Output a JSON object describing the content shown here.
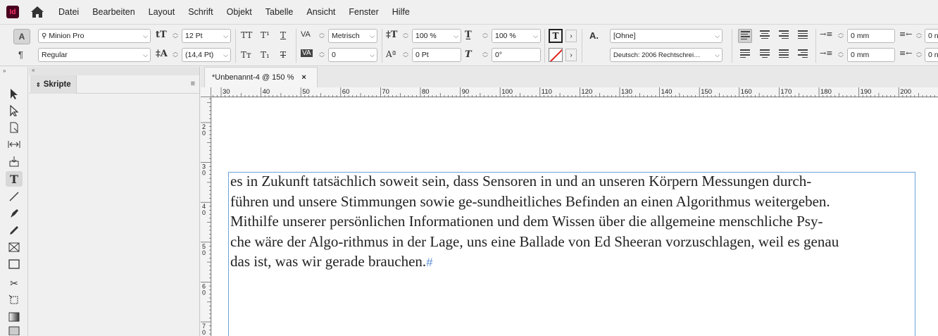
{
  "app": {
    "logo": "Id"
  },
  "menu": [
    "Datei",
    "Bearbeiten",
    "Layout",
    "Schrift",
    "Objekt",
    "Tabelle",
    "Ansicht",
    "Fenster",
    "Hilfe"
  ],
  "control": {
    "font_family": "Minion Pro",
    "font_style": "Regular",
    "font_size": "12 Pt",
    "leading": "(14,4 Pt)",
    "kerning": "Metrisch",
    "tracking": "0",
    "vertical_scale": "100 %",
    "horizontal_scale": "100 %",
    "baseline_shift": "0 Pt",
    "skew": "0°",
    "char_style": "[Ohne]",
    "language": "Deutsch: 2006 Rechtschrei…",
    "left_indent": "0 mm",
    "first_line_indent": "0 mm",
    "right_indent": "0 n",
    "last_line_indent": "0 n"
  },
  "panel": {
    "tab_label": "Skripte"
  },
  "document": {
    "tab_label": "*Unbenannt-4 @ 150 %",
    "ruler_top_ticks": [
      "30",
      "40",
      "50",
      "60",
      "70",
      "80",
      "90",
      "100",
      "110",
      "120",
      "130",
      "140",
      "150",
      "160",
      "170",
      "180",
      "190",
      "200"
    ],
    "ruler_left_ticks": [
      "2\n0",
      "3\n0",
      "4\n0",
      "5\n0",
      "6\n0",
      "7\n0"
    ],
    "text_lines": [
      "es in Zukunft tatsächlich soweit sein, dass Sensoren in und an unseren Körpern Messungen durch-",
      "führen und unsere Stimmungen sowie ge-sundheitliches Befinden an einen Algorithmus weitergeben.",
      "Mithilfe unserer persönlichen Informationen und dem Wissen über die allgemeine menschliche Psy-",
      "che wäre der Algo-rithmus in der Lage, uns eine Ballade von Ed Sheeran vorzuschlagen, weil es genau",
      "das ist, was wir gerade brauchen."
    ],
    "end_mark": "#"
  }
}
